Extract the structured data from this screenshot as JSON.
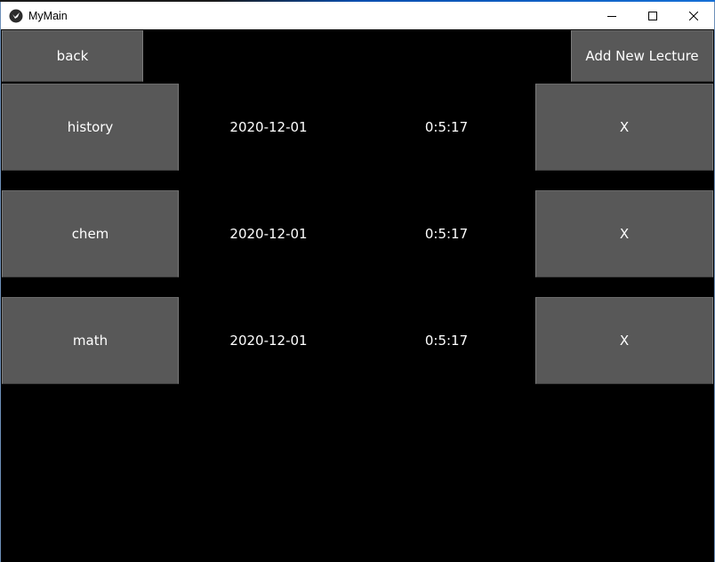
{
  "window": {
    "title": "MyMain"
  },
  "toolbar": {
    "back_label": "back",
    "add_label": "Add New Lecture"
  },
  "lectures": [
    {
      "name": "history",
      "date": "2020-12-01",
      "duration": "0:5:17",
      "delete_label": "X"
    },
    {
      "name": "chem",
      "date": "2020-12-01",
      "duration": "0:5:17",
      "delete_label": "X"
    },
    {
      "name": "math",
      "date": "2020-12-01",
      "duration": "0:5:17",
      "delete_label": "X"
    }
  ],
  "icons": {
    "app": "kivy-app-icon",
    "minimize": "minimize-icon",
    "maximize": "maximize-icon",
    "close": "close-icon"
  },
  "colors": {
    "background": "#000000",
    "button": "#585858",
    "text": "#ffffff"
  }
}
